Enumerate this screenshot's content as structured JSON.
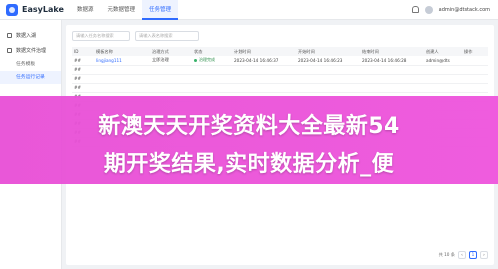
{
  "app": {
    "name": "EasyLake"
  },
  "nav": {
    "tabs": [
      "数据源",
      "元数据管理",
      "任务管理"
    ],
    "active": 2
  },
  "user": {
    "email": "admin@dtstack.com"
  },
  "sidebar": {
    "items": [
      {
        "label": "数据入湖",
        "icon": "import-icon"
      },
      {
        "label": "数据文件治理",
        "icon": "folder-icon"
      }
    ],
    "subs": [
      {
        "label": "任务模板",
        "active": false
      },
      {
        "label": "任务运行记录",
        "active": true
      }
    ]
  },
  "toolbar": {
    "search_placeholder": "请输入任务名称搜索",
    "search2_placeholder": "请输入表名称搜索"
  },
  "table": {
    "headers": [
      "ID",
      "模板名称",
      "治理方式",
      "状态",
      "计划时间",
      "开始时间",
      "结束时间",
      "创建人",
      "操作"
    ],
    "rows": [
      [
        "##",
        "lingjiang111",
        "立即治理",
        "治理完成",
        "2023-04-14 16:46:37",
        "2023-04-14 16:46:23",
        "2023-04-14 16:46:28",
        "admin@dts",
        ""
      ],
      [
        "##",
        "",
        "",
        "",
        "",
        "",
        "",
        "",
        ""
      ],
      [
        "##",
        "",
        "",
        "",
        "",
        "",
        "",
        "",
        ""
      ],
      [
        "##",
        "",
        "",
        "",
        "",
        "",
        "",
        "",
        ""
      ],
      [
        "##",
        "",
        "",
        "",
        "",
        "",
        "",
        "",
        ""
      ],
      [
        "##",
        "",
        "",
        "",
        "",
        "",
        "",
        "",
        ""
      ],
      [
        "##",
        "",
        "",
        "",
        "",
        "",
        "",
        "",
        ""
      ],
      [
        "##",
        "",
        "",
        "",
        "",
        "",
        "",
        "",
        ""
      ],
      [
        "##",
        "",
        "",
        "",
        "",
        "",
        "",
        "",
        ""
      ],
      [
        "##",
        "",
        "",
        "",
        "",
        "",
        "",
        "",
        ""
      ]
    ]
  },
  "pager": {
    "total": "共 10 条"
  },
  "banner": {
    "line1": "新澳天天开奖资料大全最新54",
    "line2": "期开奖结果,实时数据分析_便"
  },
  "colors": {
    "accent": "#2f6bff",
    "banner": "#ec52da"
  }
}
